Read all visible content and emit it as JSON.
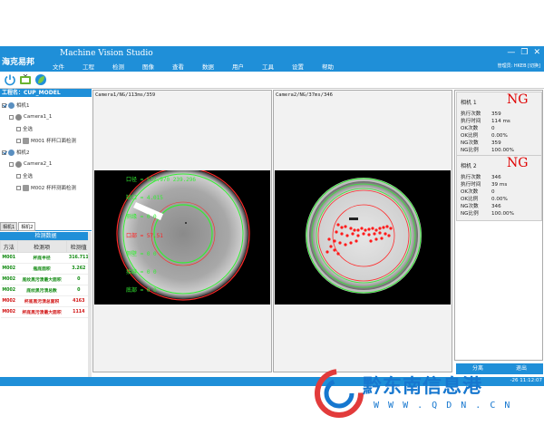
{
  "app": {
    "logo_text": "海克易邦",
    "title": "Machine Vision Studio",
    "menus": [
      "文件",
      "工程",
      "检测",
      "图像",
      "查看",
      "数据",
      "用户",
      "工具",
      "设置",
      "帮助"
    ],
    "user_text": "管理员: HKEB",
    "switch_text": "[切换]"
  },
  "project": {
    "label": "工程名：CUP_MODEL",
    "tree": [
      {
        "label": "相机1",
        "checked": true
      },
      {
        "label": "Camera1_1",
        "checked": false
      },
      {
        "label": "全选",
        "checked": false
      },
      {
        "label": "M001 杯杯口面检测",
        "checked": false
      },
      {
        "label": "相机2",
        "checked": true
      },
      {
        "label": "Camera2_1",
        "checked": false
      },
      {
        "label": "全选",
        "checked": false
      },
      {
        "label": "M002 杯杯测面检测",
        "checked": false
      }
    ]
  },
  "tabs": [
    "相机1",
    "相机2"
  ],
  "detection": {
    "title": "检测数据",
    "headers": [
      "方法",
      "检测项",
      "检测值"
    ],
    "rows": [
      {
        "method": "M001",
        "item": "杯底半径",
        "value": "316.711",
        "status": "ok"
      },
      {
        "method": "M002",
        "item": "瓶底面积",
        "value": "3.262",
        "status": "ok"
      },
      {
        "method": "M002",
        "item": "底纹黑污渍最大面积",
        "value": "0",
        "status": "ok"
      },
      {
        "method": "M002",
        "item": "底纹黑污渍总数",
        "value": "0",
        "status": "ok"
      },
      {
        "method": "M002",
        "item": "杯底黑污渍总面积",
        "value": "4163",
        "status": "ng"
      },
      {
        "method": "M002",
        "item": "杯底黑污渍最大面积",
        "value": "1114",
        "status": "ng"
      }
    ]
  },
  "cameras": [
    {
      "title": "Camera1/NG/113ms/359",
      "overlay": [
        {
          "text": "口径 = 532.970 239.296",
          "color": "green"
        },
        {
          "text": "缺口 = 4.015",
          "color": "green"
        },
        {
          "text": "侧缘 = 0 0",
          "color": "green"
        },
        {
          "text": "口部 = 57.51",
          "color": "red"
        },
        {
          "text": "侧壁 = 0 0",
          "color": "green"
        },
        {
          "text": "接缝 = 0 0",
          "color": "green"
        },
        {
          "text": "底部 = 0 0",
          "color": "green"
        }
      ]
    },
    {
      "title": "Camera2/NG/37ms/346",
      "overlay": []
    }
  ],
  "stats": [
    {
      "name": "相机 1",
      "result": "NG",
      "rows": [
        {
          "k": "执行次数",
          "v": "359"
        },
        {
          "k": "执行时间",
          "v": "114 ms"
        },
        {
          "k": "OK次数",
          "v": "0"
        },
        {
          "k": "OK比例",
          "v": "0.00%"
        },
        {
          "k": "NG次数",
          "v": "359"
        },
        {
          "k": "NG比例",
          "v": "100.00%"
        }
      ]
    },
    {
      "name": "相机 2",
      "result": "NG",
      "rows": [
        {
          "k": "执行次数",
          "v": "346"
        },
        {
          "k": "执行时间",
          "v": "39 ms"
        },
        {
          "k": "OK次数",
          "v": "0"
        },
        {
          "k": "OK比例",
          "v": "0.00%"
        },
        {
          "k": "NG次数",
          "v": "346"
        },
        {
          "k": "NG比例",
          "v": "100.00%"
        }
      ]
    }
  ],
  "buttons": {
    "reset": "分离",
    "exit": "退出"
  },
  "status": {
    "time": "-26 11:12:07"
  },
  "watermark": {
    "text": "黔东南信息港",
    "url": "W W W . Q D N . C N"
  },
  "colors": {
    "accent": "#1f8fd8",
    "ng": "#e00000",
    "ok": "#118a11",
    "overlay_green": "#33ee33"
  }
}
